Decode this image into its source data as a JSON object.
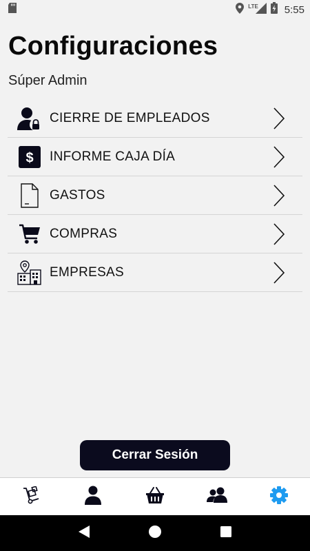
{
  "status_bar": {
    "time": "5:55",
    "network_label": "LTE",
    "icons": [
      "sd-card-icon",
      "location-icon",
      "signal-icon",
      "battery-charging-icon"
    ]
  },
  "page": {
    "title": "Configuraciones",
    "subtitle": "Súper Admin"
  },
  "menu": {
    "items": [
      {
        "label": "CIERRE DE EMPLEADOS",
        "icon": "user-lock-icon"
      },
      {
        "label": "INFORME CAJA DÍA",
        "icon": "dollar-icon"
      },
      {
        "label": "GASTOS",
        "icon": "document-icon"
      },
      {
        "label": "COMPRAS",
        "icon": "shopping-cart-icon"
      },
      {
        "label": "EMPRESAS",
        "icon": "building-location-icon"
      }
    ]
  },
  "logout_label": "Cerrar Sesión",
  "bottom_nav": {
    "items": [
      {
        "icon": "hand-truck-icon",
        "active": false
      },
      {
        "icon": "user-icon",
        "active": false
      },
      {
        "icon": "basket-icon",
        "active": false
      },
      {
        "icon": "users-icon",
        "active": false
      },
      {
        "icon": "gear-icon",
        "active": true
      }
    ]
  },
  "colors": {
    "background": "#f2f2f2",
    "primary_dark": "#0b0b1e",
    "active_tab": "#1e9bf0",
    "inactive_icon": "#0a0a1a"
  }
}
